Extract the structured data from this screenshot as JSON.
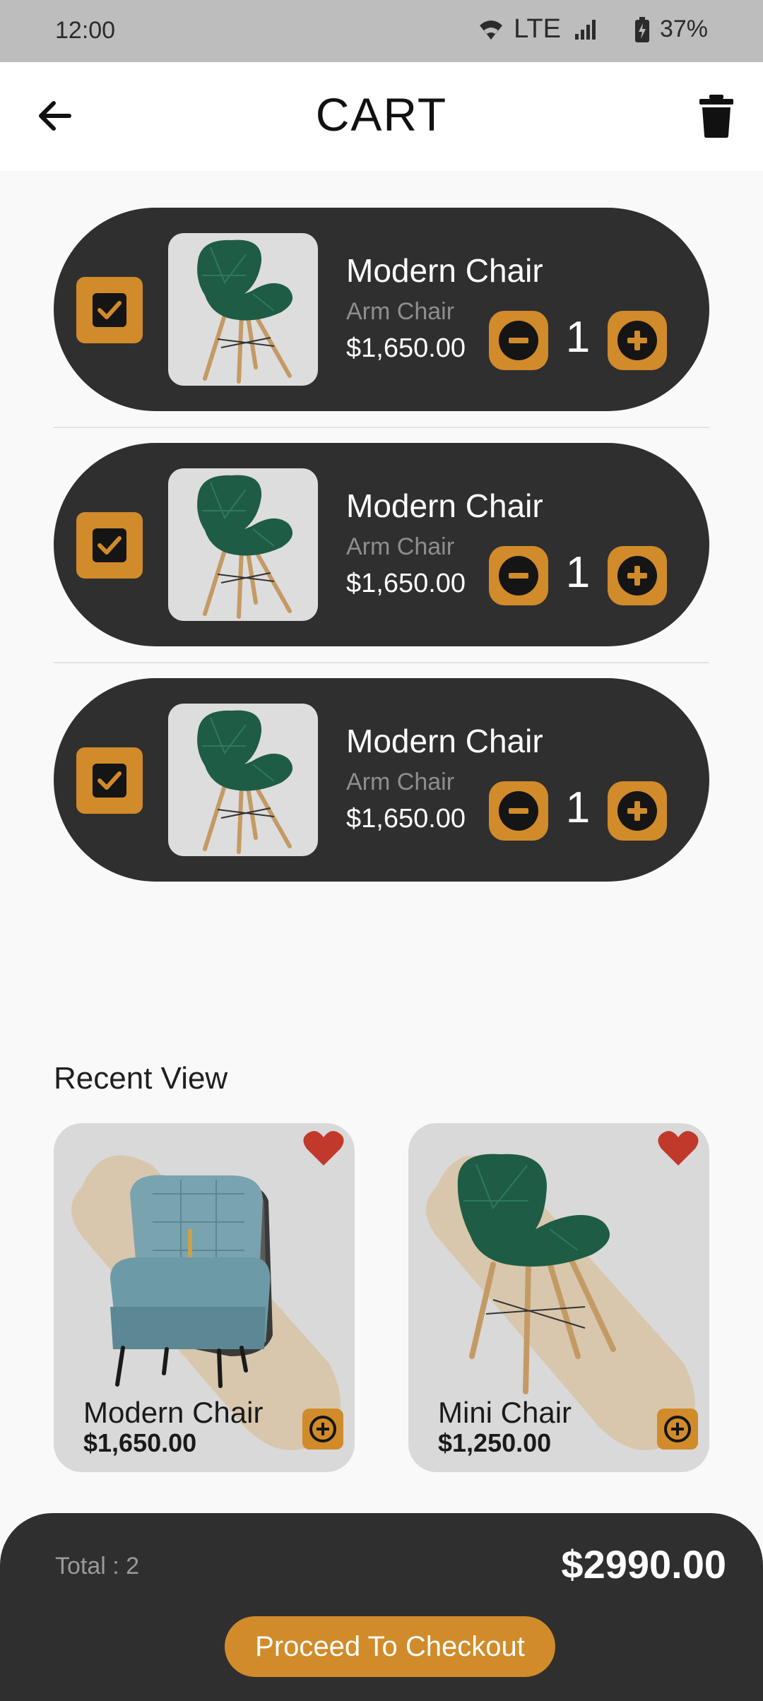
{
  "status_bar": {
    "time": "12:00",
    "network": "LTE",
    "battery": "37%",
    "icons": [
      "wifi-icon",
      "signal-icon",
      "battery-charging-icon"
    ]
  },
  "header": {
    "title": "CART",
    "back_icon": "arrow-left-icon",
    "delete_icon": "trash-icon"
  },
  "cart": {
    "items": [
      {
        "name": "Modern Chair",
        "category": "Arm Chair",
        "price": "$1,650.00",
        "quantity": "1",
        "checked": true
      },
      {
        "name": "Modern Chair",
        "category": "Arm Chair",
        "price": "$1,650.00",
        "quantity": "1",
        "checked": true
      },
      {
        "name": "Modern Chair",
        "category": "Arm Chair",
        "price": "$1,650.00",
        "quantity": "1",
        "checked": true
      }
    ]
  },
  "recent_view": {
    "title": "Recent View",
    "items": [
      {
        "name": "Modern Chair",
        "price": "$1,650.00",
        "favorite": true
      },
      {
        "name": "Mini Chair",
        "price": "$1,250.00",
        "favorite": true
      }
    ]
  },
  "checkout": {
    "total_label": "Total : 2",
    "total_amount": "$2990.00",
    "button_label": "Proceed To Checkout"
  },
  "colors": {
    "accent": "#d18b2a",
    "card_dark": "#2f2f2f",
    "background": "#f9f9f9",
    "heart": "#c0392b"
  }
}
